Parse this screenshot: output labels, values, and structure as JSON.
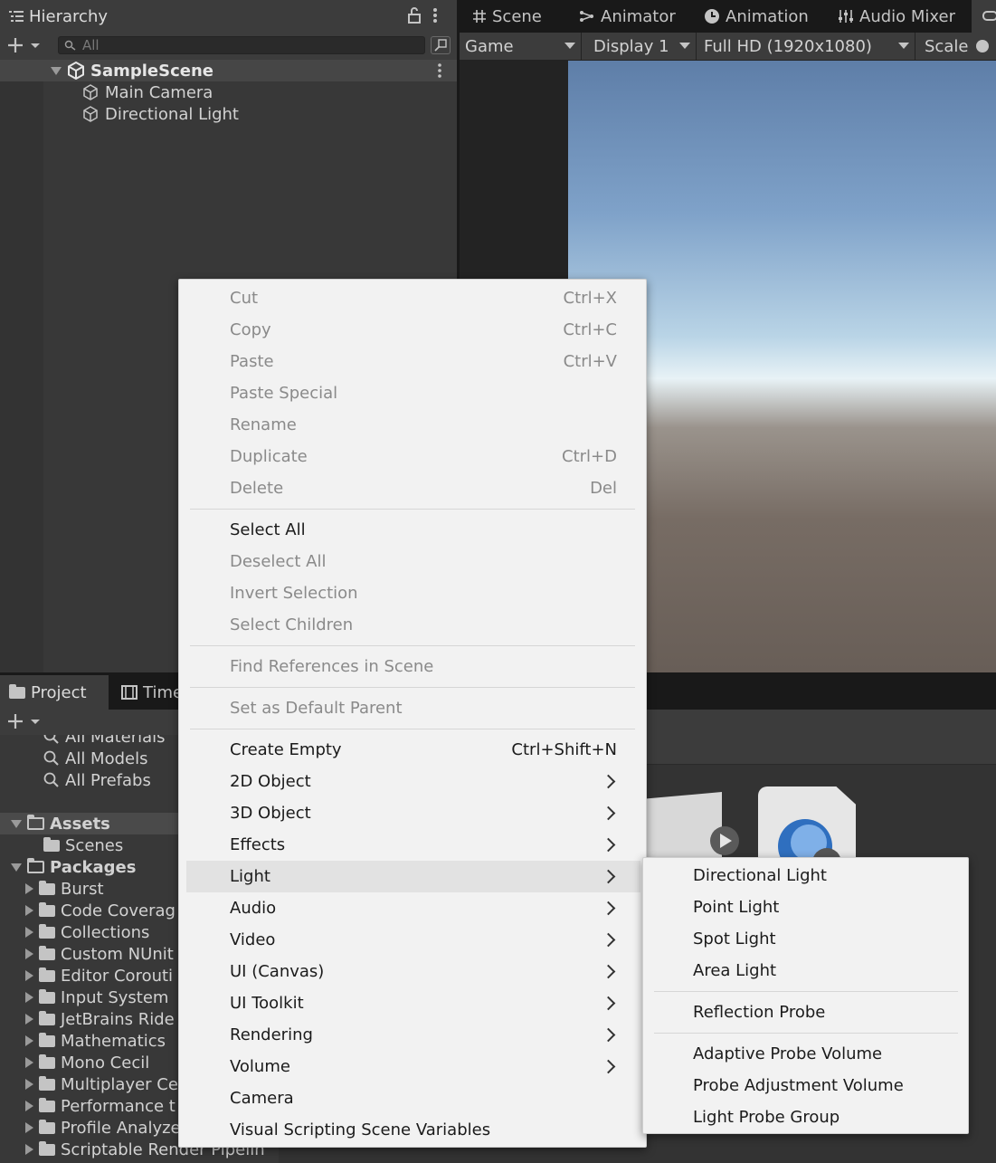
{
  "top_tabs": {
    "hierarchy": "Hierarchy",
    "scene": "Scene",
    "animator": "Animator",
    "animation": "Animation",
    "audio_mixer": "Audio Mixer"
  },
  "hierarchy": {
    "search_placeholder": "All",
    "scene_name": "SampleScene",
    "items": [
      {
        "label": "Main Camera"
      },
      {
        "label": "Directional Light"
      }
    ]
  },
  "game_toolbar": {
    "view": "Game",
    "display": "Display 1",
    "resolution": "Full HD (1920x1080)",
    "scale_label": "Scale"
  },
  "project_tabs": {
    "project": "Project",
    "timeline": "Time"
  },
  "project_tree": {
    "favorites": [
      "All Materials",
      "All Models",
      "All Prefabs"
    ],
    "assets": "Assets",
    "assets_children": [
      "Scenes"
    ],
    "packages": "Packages",
    "packages_children": [
      "Burst",
      "Code Coverag",
      "Collections",
      "Custom NUnit",
      "Editor Corouti",
      "Input System",
      "JetBrains Ride",
      "Mathematics",
      "Mono Cecil",
      "Multiplayer Ce",
      "Performance t",
      "Profile Analyze",
      "Scriptable Render Pipelin"
    ]
  },
  "context_menu": {
    "cut": "Cut",
    "cut_sc": "Ctrl+X",
    "copy": "Copy",
    "copy_sc": "Ctrl+C",
    "paste": "Paste",
    "paste_sc": "Ctrl+V",
    "paste_special": "Paste Special",
    "rename": "Rename",
    "duplicate": "Duplicate",
    "duplicate_sc": "Ctrl+D",
    "delete": "Delete",
    "delete_sc": "Del",
    "select_all": "Select All",
    "deselect_all": "Deselect All",
    "invert_selection": "Invert Selection",
    "select_children": "Select Children",
    "find_refs": "Find References in Scene",
    "set_default_parent": "Set as Default Parent",
    "create_empty": "Create Empty",
    "create_empty_sc": "Ctrl+Shift+N",
    "obj2d": "2D Object",
    "obj3d": "3D Object",
    "effects": "Effects",
    "light": "Light",
    "audio": "Audio",
    "video": "Video",
    "ui_canvas": "UI (Canvas)",
    "ui_toolkit": "UI Toolkit",
    "rendering": "Rendering",
    "volume": "Volume",
    "camera": "Camera",
    "visual_scripting": "Visual Scripting Scene Variables"
  },
  "light_submenu": {
    "directional": "Directional Light",
    "point": "Point Light",
    "spot": "Spot Light",
    "area": "Area Light",
    "reflection_probe": "Reflection Probe",
    "adaptive_probe_volume": "Adaptive Probe Volume",
    "probe_adjustment_volume": "Probe Adjustment Volume",
    "light_probe_group": "Light Probe Group"
  },
  "colors": {
    "menu_bg": "#f2f2f2",
    "menu_disabled": "#8a8a8a",
    "panel_bg": "#383838"
  }
}
